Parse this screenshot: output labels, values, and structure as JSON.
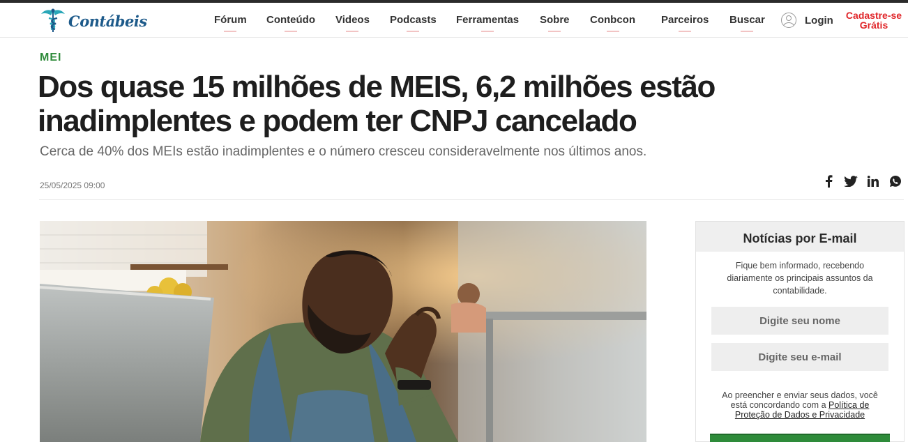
{
  "brand": {
    "name": "Contábeis",
    "accent": "#1d5a8a",
    "logo_icon": "caduceus-icon"
  },
  "nav": {
    "items": [
      "Fórum",
      "Conteúdo",
      "Videos",
      "Podcasts",
      "Ferramentas",
      "Sobre",
      "Conbcon",
      "Parceiros",
      "Buscar"
    ],
    "login": "Login",
    "signup": "Cadastre-se Grátis",
    "signup_color": "#e0262a"
  },
  "article": {
    "category": "MEI",
    "category_color": "#2e8b3a",
    "title": "Dos quase 15 milhões de MEIS, 6,2 milhões estão inadimplentes e podem ter CNPJ cancelado",
    "subtitle": "Cerca de 40% dos MEIs estão inadimplentes e o número cresceu consideravelmente nos últimos anos.",
    "date": "25/05/2025 09:00",
    "share_icons": [
      "facebook-icon",
      "twitter-icon",
      "linkedin-icon",
      "whatsapp-icon"
    ]
  },
  "sidebar": {
    "title": "Notícias por E-mail",
    "description": "Fique bem informado, recebendo diariamente os principais assuntos da contabilidade.",
    "name_placeholder": "Digite seu nome",
    "email_placeholder": "Digite seu e-mail",
    "consent_prefix": "Ao preencher e enviar seus dados, você está concordando com a",
    "consent_link": "Política de Proteção de Dados e Privacidade"
  }
}
